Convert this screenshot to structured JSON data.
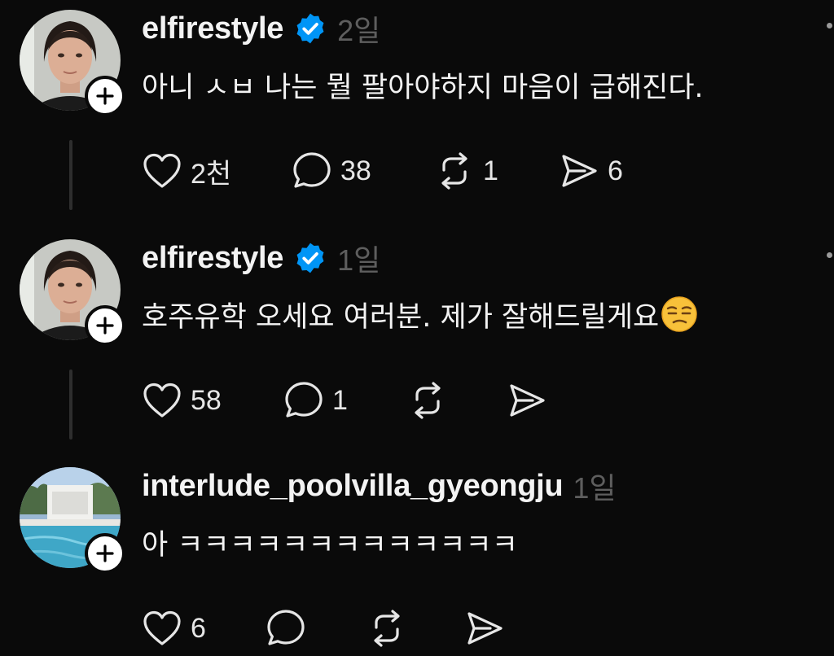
{
  "posts": [
    {
      "username": "elfirestyle",
      "timestamp": "2일",
      "text": "아니 ㅅㅂ 나는 뭘 팔아야하지 마음이 급해진다.",
      "verified": true,
      "avatar_type": "woman-portrait",
      "counts": {
        "likes": "2천",
        "replies": "38",
        "reposts": "1",
        "shares": "6"
      }
    },
    {
      "username": "elfirestyle",
      "timestamp": "1일",
      "text": "호주유학 오세요 여러분. 제가 잘해드릴게요",
      "verified": true,
      "emoji": "unamused-face-emoji",
      "avatar_type": "woman-portrait",
      "counts": {
        "likes": "58",
        "replies": "1",
        "reposts": "",
        "shares": ""
      }
    },
    {
      "username": "interlude_poolvilla_gyeongju",
      "timestamp": "1일",
      "text": "아 ㅋㅋㅋㅋㅋㅋㅋㅋㅋㅋㅋㅋㅋ",
      "verified": false,
      "avatar_type": "pool-villa-photo",
      "counts": {
        "likes": "6",
        "replies": "",
        "reposts": "",
        "shares": ""
      }
    }
  ],
  "icons": {
    "like": "heart-icon",
    "reply": "comment-icon",
    "repost": "repost-icon",
    "share": "send-icon",
    "follow": "plus-icon",
    "verified": "verified-badge-icon",
    "more": "more-options-icon"
  },
  "colors": {
    "background": "#0a0a0a",
    "text": "#f3f3f3",
    "timestamp": "#5e5e5e",
    "verified": "#0095f6",
    "thread_line": "#2e2e2e"
  }
}
